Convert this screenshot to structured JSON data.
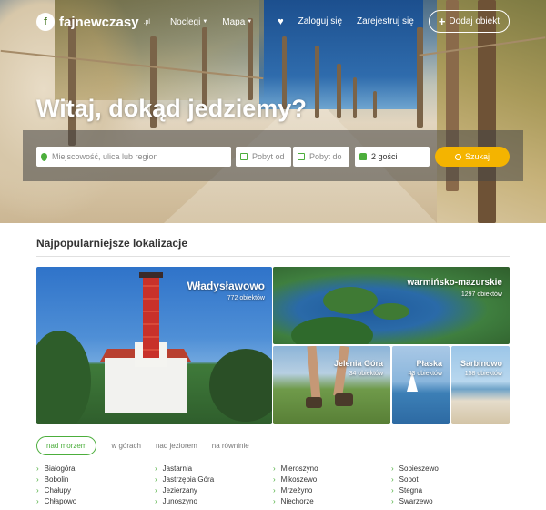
{
  "header": {
    "logo_text": "fajnewczasy",
    "logo_suffix": ".pl",
    "nav": [
      "Noclegi",
      "Mapa"
    ],
    "login": "Zaloguj się",
    "register": "Zarejestruj się",
    "add_listing": "Dodaj obiekt"
  },
  "hero": {
    "title": "Witaj, dokąd jedziemy?",
    "search": {
      "location_placeholder": "Miejscowość, ulica lub region",
      "date_from": "Pobyt od",
      "date_to": "Pobyt do",
      "guests": "2 gości",
      "button": "Szukaj"
    }
  },
  "popular": {
    "title": "Najpopularniejsze lokalizacje",
    "tiles": [
      {
        "name": "Władysławowo",
        "count": "772 obiektów"
      },
      {
        "name": "warmińsko-mazurskie",
        "count": "1297 obiektów"
      },
      {
        "name": "Jelenia Góra",
        "count": "34 obiektów"
      },
      {
        "name": "Płaska",
        "count": "43 obiektów"
      },
      {
        "name": "Sarbinowo",
        "count": "158 obiektów"
      }
    ],
    "tabs": [
      "nad morzem",
      "w górach",
      "nad jeziorem",
      "na równinie"
    ],
    "columns": [
      [
        "Białogóra",
        "Bobolin",
        "Chałupy",
        "Chłapowo"
      ],
      [
        "Jastarnia",
        "Jastrzębia Góra",
        "Jezierzany",
        "Junoszyno"
      ],
      [
        "Mieroszyno",
        "Mikoszewo",
        "Mrzeżyno",
        "Niechorze"
      ],
      [
        "Sobieszewo",
        "Sopot",
        "Stegna",
        "Swarzewo"
      ]
    ]
  },
  "colors": {
    "accent": "#4cae3c",
    "search_button": "#f4b400"
  },
  "icons": [
    "logo-icon",
    "chevron-down-icon",
    "heart-icon",
    "plus-icon",
    "pin-icon",
    "calendar-icon",
    "user-icon",
    "search-icon",
    "chevron-right-icon"
  ]
}
